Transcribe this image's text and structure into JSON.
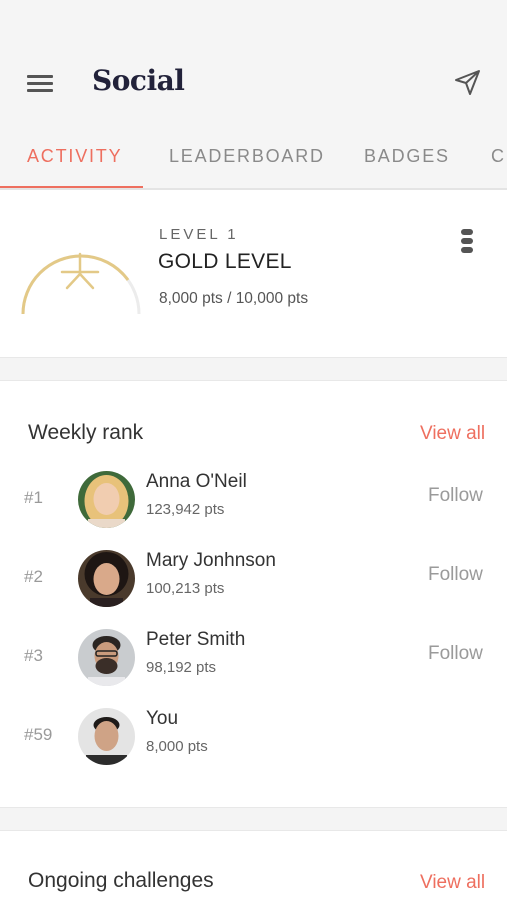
{
  "header": {
    "title": "Social",
    "menu_icon": "hamburger-menu-icon",
    "send_icon": "send-icon"
  },
  "tabs": [
    {
      "label": "ACTIVITY",
      "active": true
    },
    {
      "label": "LEADERBOARD",
      "active": false
    },
    {
      "label": "BADGES",
      "active": false
    },
    {
      "label": "CH",
      "active": false
    }
  ],
  "level": {
    "label": "LEVEL 1",
    "name": "GOLD LEVEL",
    "points_text": "8,000 pts / 10,000 pts",
    "progress": 0.8,
    "ring_color": "#e3c987",
    "icon": "star-icon",
    "more_icon": "more-vertical-icon"
  },
  "weekly_rank": {
    "title": "Weekly rank",
    "view_all": "View all",
    "rows": [
      {
        "rank": "#1",
        "name": "Anna O'Neil",
        "pts": "123,942 pts",
        "action": "Follow"
      },
      {
        "rank": "#2",
        "name": "Mary Jonhnson",
        "pts": "100,213 pts",
        "action": "Follow"
      },
      {
        "rank": "#3",
        "name": "Peter Smith",
        "pts": "98,192 pts",
        "action": "Follow"
      },
      {
        "rank": "#59",
        "name": "You",
        "pts": "8,000 pts",
        "action": ""
      }
    ]
  },
  "challenges": {
    "title": "Ongoing challenges",
    "view_all": "View all"
  },
  "colors": {
    "accent": "#ee6f5f",
    "gold": "#e3c987",
    "background": "#f4f4f4"
  }
}
